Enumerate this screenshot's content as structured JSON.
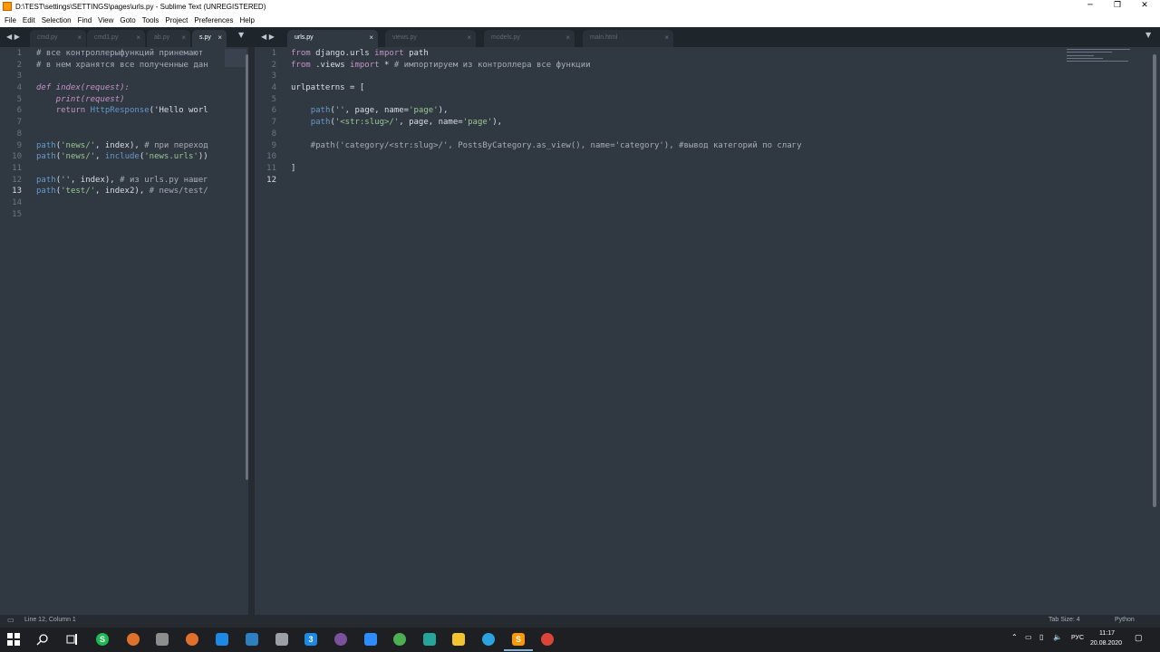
{
  "window": {
    "title": "D:\\TEST\\settings\\SETTINGS\\pages\\urls.py - Sublime Text (UNREGISTERED)",
    "minimize": "─",
    "maximize": "❐",
    "close": "✕"
  },
  "menu": [
    "File",
    "Edit",
    "Selection",
    "Find",
    "View",
    "Goto",
    "Tools",
    "Project",
    "Preferences",
    "Help"
  ],
  "left_group": {
    "nav": "◀ ▶",
    "tabs": [
      {
        "label": "cmd.py",
        "close": "×"
      },
      {
        "label": "cmd1.py",
        "close": "×"
      },
      {
        "label": "ab.py",
        "close": "×"
      },
      {
        "label": "s.py",
        "close": "×"
      }
    ],
    "dropdown": "▼",
    "line_numbers": [
      "1",
      "2",
      "3",
      "4",
      "5",
      "6",
      "7",
      "8",
      "9",
      "10",
      "11",
      "12",
      "13",
      "14",
      "15"
    ],
    "lines": [
      "# все контроллерыфункций принемают",
      "# в нем хранятся все полученные дан",
      "",
      "def index(request):",
      "    print(request)",
      "    return HttpResponse('Hello worl",
      "",
      "",
      "path('news/', index), # при переход",
      "path('news/', include('news.urls'))",
      "",
      "path('', index), # из urls.py нашег",
      "path('test/', index2), # news/test/",
      "",
      ""
    ]
  },
  "right_group": {
    "nav": "◀ ▶",
    "tabs": [
      {
        "label": "urls.py",
        "close": "×",
        "active": true
      },
      {
        "label": "views.py",
        "close": "×"
      },
      {
        "label": "models.py",
        "close": "×"
      },
      {
        "label": "main.html",
        "close": "×"
      }
    ],
    "dropdown": "▼",
    "line_numbers": [
      "1",
      "2",
      "3",
      "4",
      "5",
      "6",
      "7",
      "8",
      "9",
      "10",
      "11",
      "12"
    ],
    "lines": [
      "from django.urls import path",
      "from .views import * # импортируем из контроллера все функции",
      "",
      "urlpatterns = [",
      "",
      "    path('', page, name='page'),",
      "    path('<str:slug>/', page, name='page'),",
      "",
      "    #path('category/<str:slug>/', PostsByCategory.as_view(), name='category'), #вывод категорий по слагу",
      "",
      "]",
      ""
    ]
  },
  "status": {
    "position": "Line 12, Column 1",
    "tab_size": "Tab Size: 4",
    "syntax": "Python"
  },
  "taskbar": {
    "tray_lang": "РУС",
    "time": "11:17",
    "date": "20.08.2020"
  },
  "colors": {
    "editor_bg": "#303841",
    "keyword": "#c594c5",
    "function": "#6699cc",
    "string": "#99c794",
    "comment": "#a6acb9"
  }
}
